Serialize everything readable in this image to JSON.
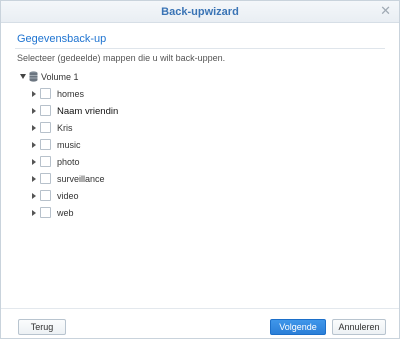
{
  "window": {
    "title": "Back-upwizard",
    "close_icon": "close-icon"
  },
  "section": {
    "title": "Gegevensback-up",
    "instruction": "Selecteer (gedeelde) mappen die u wilt back-uppen."
  },
  "tree": {
    "volume_label": "Volume 1",
    "volume_icon": "database-icon",
    "folders": [
      {
        "label": "homes",
        "checked": false
      },
      {
        "label": "Naam vriendin",
        "checked": false
      },
      {
        "label": "Kris",
        "checked": false
      },
      {
        "label": "music",
        "checked": false
      },
      {
        "label": "photo",
        "checked": false
      },
      {
        "label": "surveillance",
        "checked": false
      },
      {
        "label": "video",
        "checked": false
      },
      {
        "label": "web",
        "checked": false
      }
    ]
  },
  "footer": {
    "back_label": "Terug",
    "next_label": "Volgende",
    "cancel_label": "Annuleren"
  },
  "colors": {
    "accent": "#1f74d1",
    "title": "#3a74b5",
    "primary_button": "#2b7fd8"
  }
}
